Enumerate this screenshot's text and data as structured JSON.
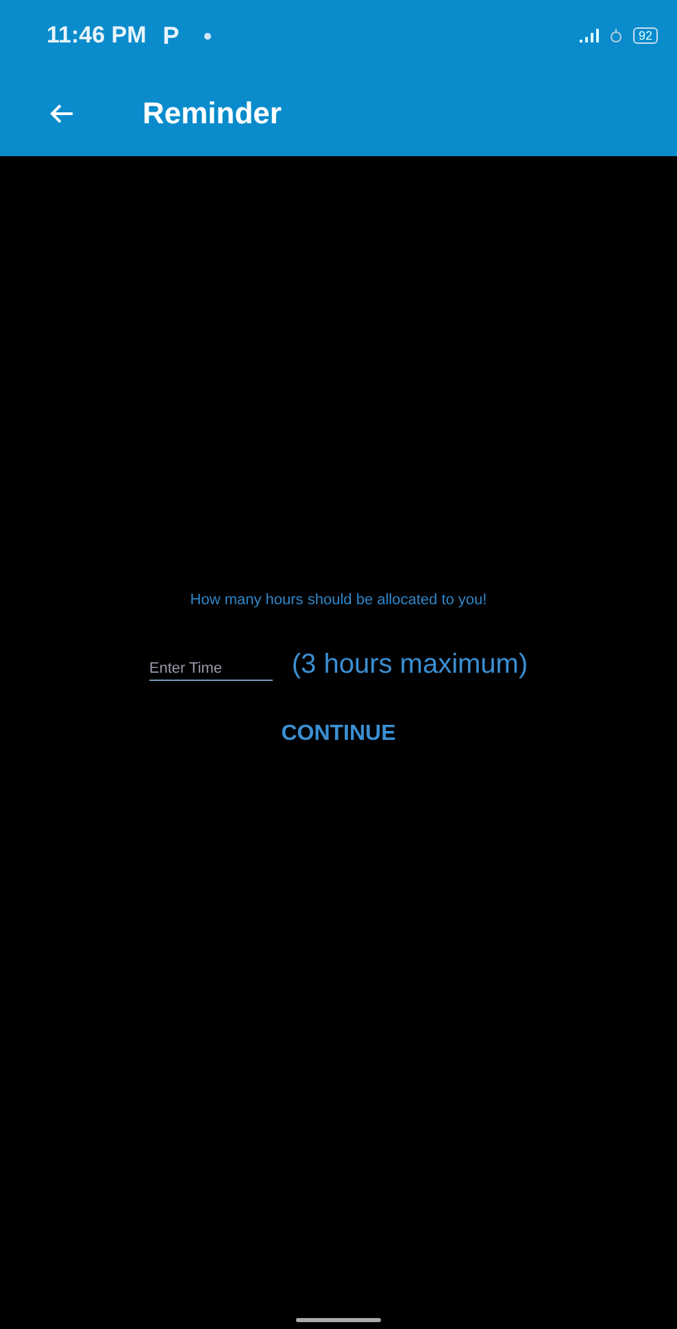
{
  "status_bar": {
    "time": "11:46 PM",
    "app_letter": "P",
    "battery": "92"
  },
  "app_bar": {
    "title": "Reminder"
  },
  "form": {
    "prompt": "How many hours should be allocated to you!",
    "time_field": {
      "placeholder": "Enter Time"
    },
    "hint": "(3 hours maximum)",
    "button": "CONTINUE"
  }
}
